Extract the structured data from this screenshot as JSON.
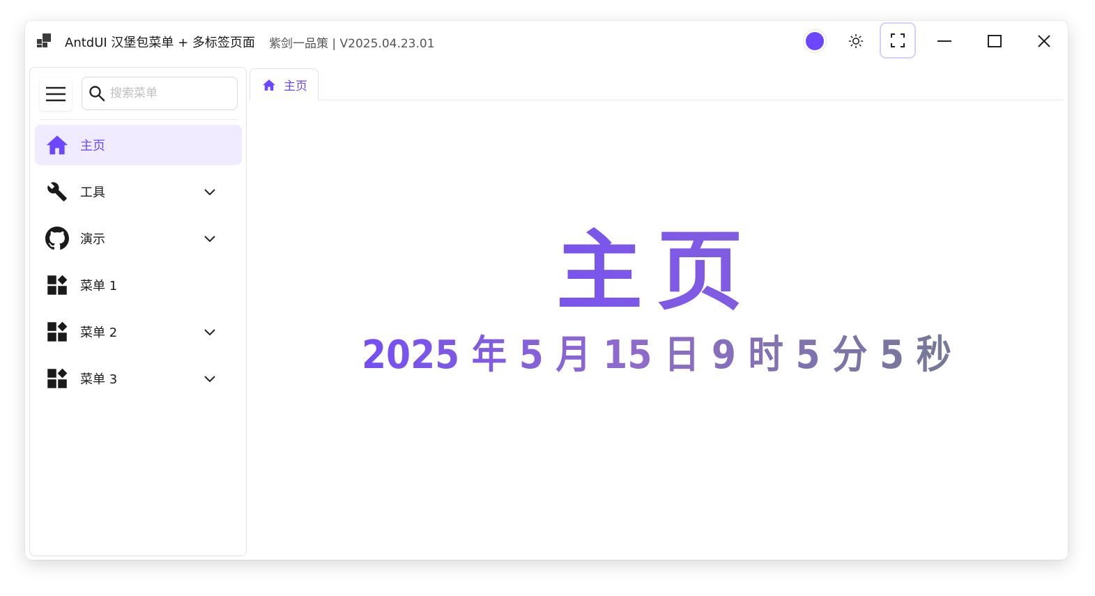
{
  "window": {
    "title": "AntdUI 汉堡包菜单 + 多标签页面",
    "subtitle": "紫剑一品策 | V2025.04.23.01"
  },
  "titlebar": {
    "logo_icon": "app-logo-icon",
    "accent_color": "#6c47ff",
    "buttons": [
      "color-picker",
      "theme-toggle",
      "fullscreen",
      "minimize",
      "maximize",
      "close"
    ]
  },
  "sidebar": {
    "search": {
      "placeholder": "搜索菜单",
      "value": ""
    },
    "items": [
      {
        "label": "主页",
        "icon": "home-icon",
        "active": true,
        "expandable": false
      },
      {
        "label": "工具",
        "icon": "wrench-icon",
        "active": false,
        "expandable": true
      },
      {
        "label": "演示",
        "icon": "github-icon",
        "active": false,
        "expandable": true
      },
      {
        "label": "菜单 1",
        "icon": "widgets-icon",
        "active": false,
        "expandable": false
      },
      {
        "label": "菜单 2",
        "icon": "widgets-icon",
        "active": false,
        "expandable": true
      },
      {
        "label": "菜单 3",
        "icon": "widgets-icon",
        "active": false,
        "expandable": true
      }
    ]
  },
  "tabs": [
    {
      "label": "主页",
      "icon": "home-icon",
      "active": true
    }
  ],
  "main": {
    "title": "主页",
    "clock": "2025 年 5 月 15 日 9 时 5 分 5 秒"
  }
}
